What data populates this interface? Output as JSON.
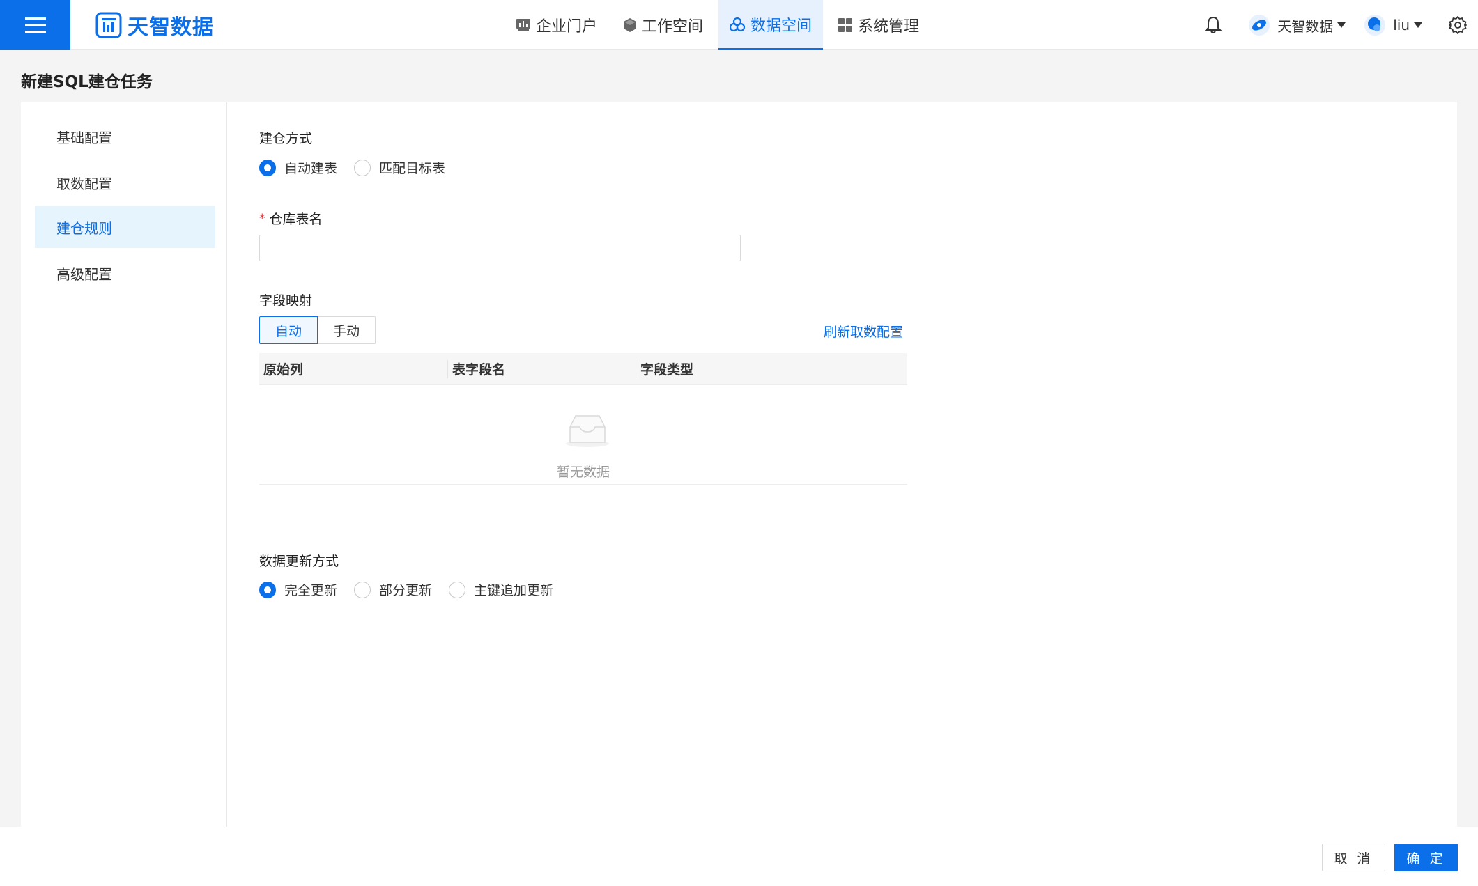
{
  "header": {
    "logo_text": "天智数据",
    "nav": [
      {
        "label": "企业门户",
        "icon": "chart-icon"
      },
      {
        "label": "工作空间",
        "icon": "cube-icon"
      },
      {
        "label": "数据空间",
        "icon": "cluster-icon",
        "active": true
      },
      {
        "label": "系统管理",
        "icon": "grid-icon"
      }
    ],
    "org_name": "天智数据",
    "user_name": "liu"
  },
  "page": {
    "title": "新建SQL建仓任务"
  },
  "sidebar": {
    "items": [
      {
        "label": "基础配置"
      },
      {
        "label": "取数配置"
      },
      {
        "label": "建仓规则",
        "active": true
      },
      {
        "label": "高级配置"
      }
    ]
  },
  "form": {
    "build_mode": {
      "label": "建仓方式",
      "options": [
        "自动建表",
        "匹配目标表"
      ],
      "selected": "自动建表"
    },
    "table_name": {
      "required_mark": "*",
      "label": "仓库表名",
      "value": "",
      "placeholder": ""
    },
    "field_mapping": {
      "label": "字段映射",
      "modes": [
        "自动",
        "手动"
      ],
      "selected_mode": "自动",
      "refresh_link": "刷新取数配置",
      "columns": [
        "原始列",
        "表字段名",
        "字段类型"
      ],
      "empty_text": "暂无数据"
    },
    "update_mode": {
      "label": "数据更新方式",
      "options": [
        "完全更新",
        "部分更新",
        "主键追加更新"
      ],
      "selected": "完全更新"
    }
  },
  "footer": {
    "cancel_label": "取 消",
    "ok_label": "确 定"
  },
  "colors": {
    "primary": "#0a6fe8",
    "required": "#f5222d"
  }
}
